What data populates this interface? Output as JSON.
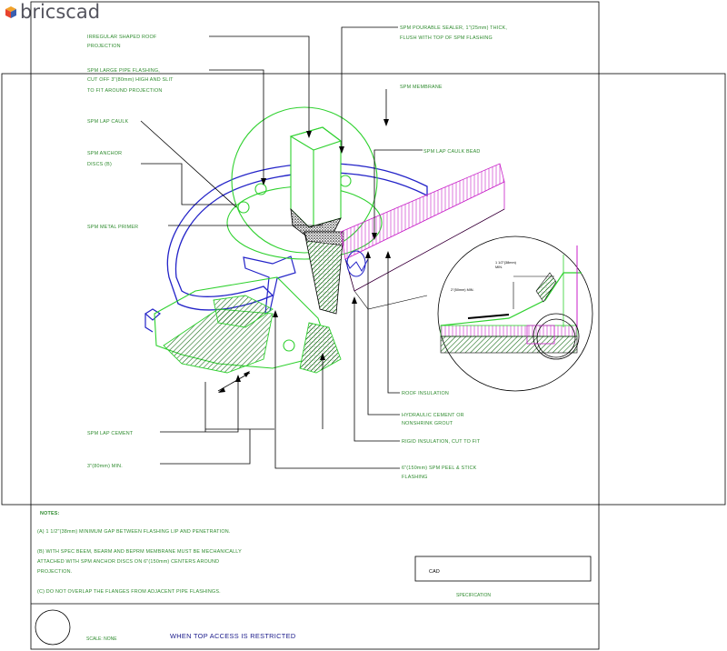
{
  "brand": {
    "name": "bricscad"
  },
  "drawing": {
    "title": "WHEN TOP ACCESS IS RESTRICTED",
    "scale": "SCALE: NONE",
    "cad_label": "CAD",
    "specification": "SPECIFICATION"
  },
  "callouts": {
    "c1": [
      "IRREGULAR SHAPED ROOF",
      "PROJECTION"
    ],
    "c2": [
      "SPM LARGE PIPE FLASHING,",
      "CUT OFF 3\"(80mm) HIGH AND SLIT",
      "TO FIT AROUND PROJECTION"
    ],
    "c3": [
      "SPM LAP CAULK"
    ],
    "c4": [
      "SPM ANCHOR",
      "DISCS (B)"
    ],
    "c5": [
      "SPM METAL PRIMER"
    ],
    "c6": [
      "SPM LAP CEMENT"
    ],
    "c7": [
      "3\"(80mm) MIN."
    ],
    "c8": [
      "SPM POURABLE SEALER, 1\"(25mm) THICK,",
      "FLUSH WITH TOP OF SPM FLASHING"
    ],
    "c9": [
      "SPM MEMBRANE"
    ],
    "c10": [
      "SPM LAP CAULK BEAD"
    ],
    "c11": [
      "ROOF INSULATION"
    ],
    "c12": [
      "HYDRAULIC CEMENT OR",
      "NONSHRINK GROUT"
    ],
    "c13": [
      "RIGID INSULATION, CUT TO FIT"
    ],
    "c14": [
      "6\"(150mm) SPM PEEL & STICK",
      "FLASHING"
    ],
    "detail_a": [
      "1 1/2\"(38mm)",
      "MIN."
    ],
    "detail_b": "2\"(50mm) MIN."
  },
  "notes": {
    "heading": "NOTES:",
    "a": "(A) 1 1/2\"(38mm) MINIMUM GAP BETWEEN FLASHING LIP AND PENETRATION.",
    "b": [
      "(B) WITH SPEC BEEM, BEARM AND BEPRM MEMBRANE MUST BE MECHANICALLY",
      "ATTACHED WITH SPM ANCHOR DISCS ON 6\"(150mm) CENTERS AROUND",
      "PROJECTION."
    ],
    "c": "(C) DO NOT OVERLAP THE FLANGES FROM ADJACENT PIPE FLASHINGS."
  },
  "colors": {
    "green": "#2fd12f",
    "blue": "#2323c8",
    "magenta": "#c81ec8",
    "black": "#000000",
    "text_green": "#2e8b2e",
    "title_blue": "#1a1a8a"
  }
}
